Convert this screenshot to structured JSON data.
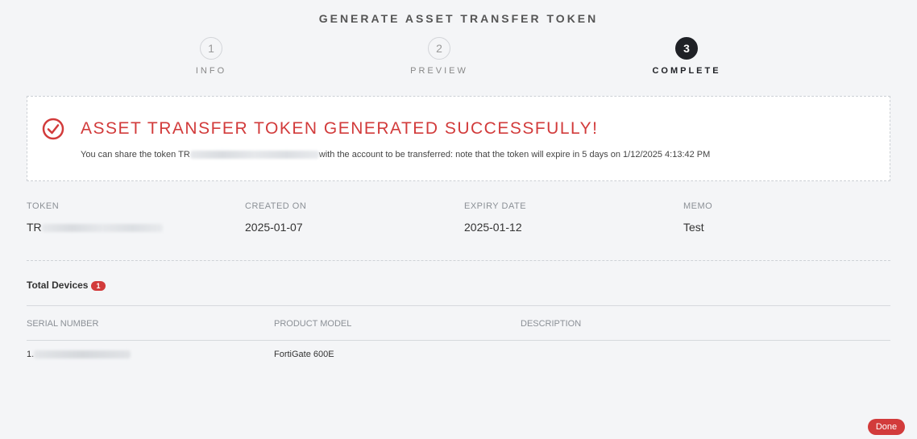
{
  "header": {
    "title": "GENERATE ASSET TRANSFER TOKEN"
  },
  "steps": [
    {
      "number": "1",
      "label": "INFO"
    },
    {
      "number": "2",
      "label": "PREVIEW"
    },
    {
      "number": "3",
      "label": "COMPLETE"
    }
  ],
  "banner": {
    "headline": "ASSET TRANSFER TOKEN GENERATED SUCCESSFULLY!",
    "message_prefix": "You can share the token TR",
    "message_suffix": "with the account to be transferred: note that the token will expire in 5 days on 1/12/2025 4:13:42 PM",
    "icon": "check-circle-icon",
    "accent": "#d23b3b"
  },
  "details": {
    "token_label": "TOKEN",
    "token_value": "TR",
    "created_label": "CREATED ON",
    "created_value": "2025-01-07",
    "expiry_label": "EXPIRY DATE",
    "expiry_value": "2025-01-12",
    "memo_label": "MEMO",
    "memo_value": "Test"
  },
  "devices": {
    "title": "Total Devices",
    "count": "1",
    "columns": [
      "SERIAL NUMBER",
      "PRODUCT MODEL",
      "DESCRIPTION"
    ],
    "rows": [
      {
        "index": "1.",
        "product_model": "FortiGate 600E",
        "description": ""
      }
    ]
  },
  "footer": {
    "done_label": "Done"
  }
}
